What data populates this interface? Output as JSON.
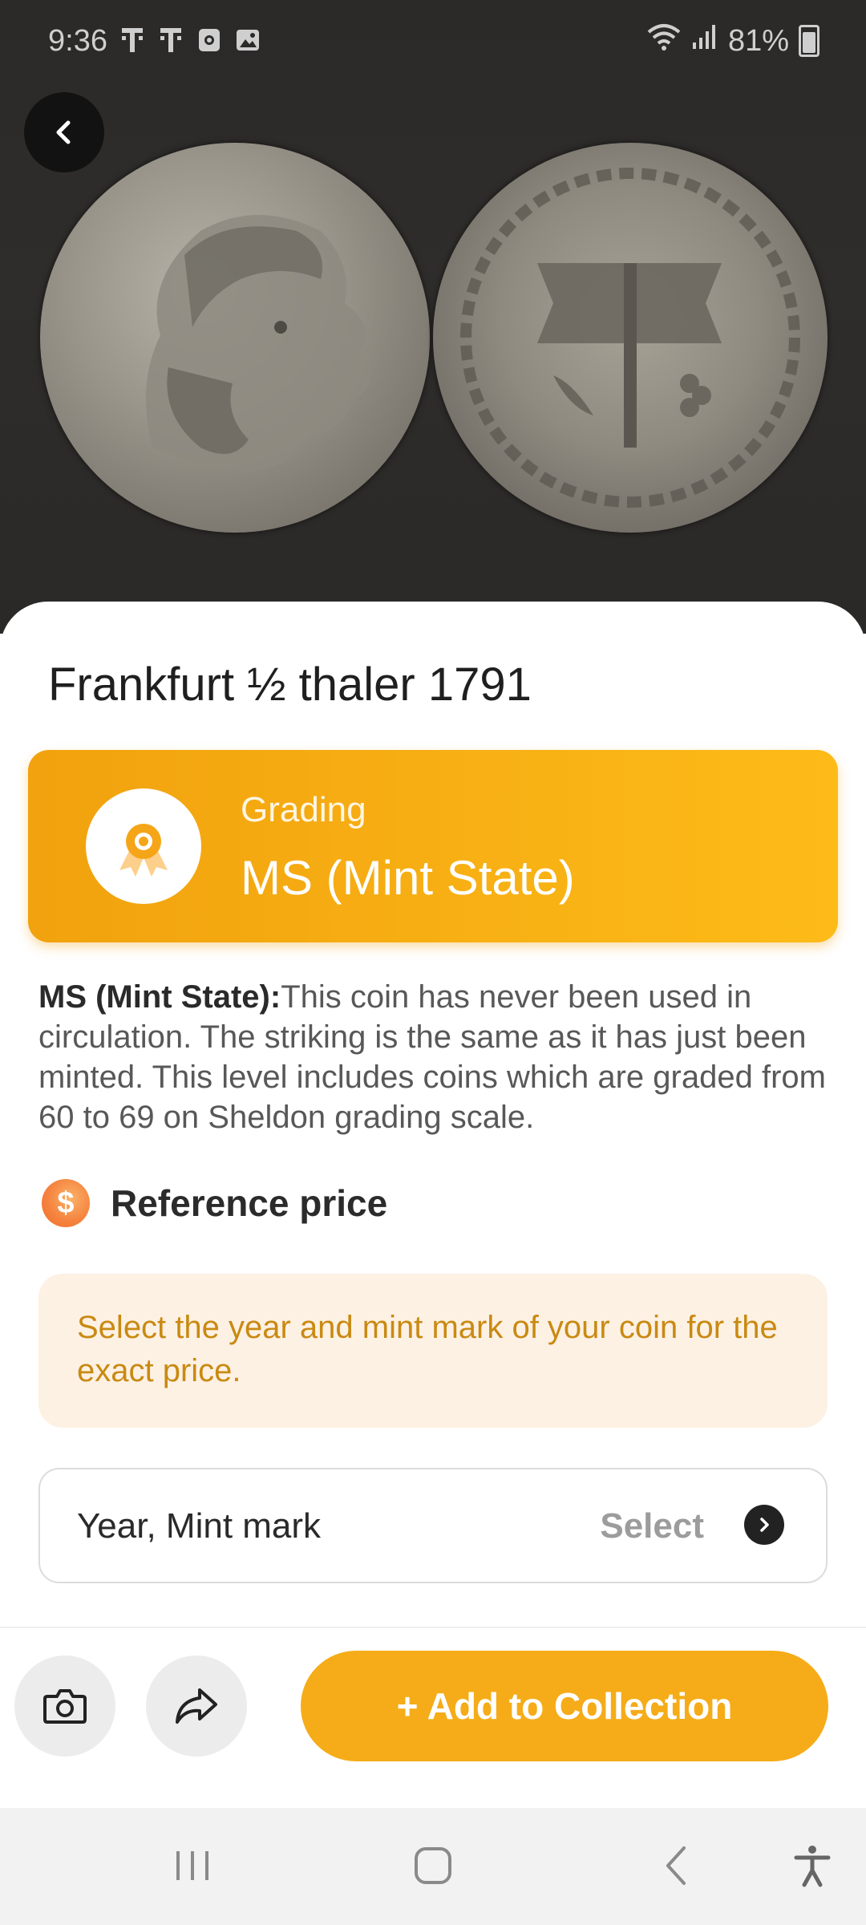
{
  "status_bar": {
    "time": "9:36",
    "battery": "81%",
    "left_icons": [
      "tmobile-icon",
      "tmobile-icon",
      "notification-icon",
      "gallery-icon"
    ],
    "right_icons": [
      "wifi-icon",
      "signal-icon",
      "battery-icon"
    ]
  },
  "coin": {
    "title": "Frankfurt ½ thaler 1791"
  },
  "grading": {
    "label": "Grading",
    "value": "MS (Mint State)",
    "icon": "award-icon",
    "accent": "#f5ac18"
  },
  "description": {
    "term": "MS (Mint State):",
    "text": "This coin has never been used in circulation. The striking is the same as it has just been minted. This level includes coins which are graded from 60 to 69 on Sheldon grading scale."
  },
  "reference_price": {
    "title": "Reference price",
    "icon_symbol": "$",
    "notice": "Select the year and mint mark of your coin for the exact price."
  },
  "year_mint": {
    "label": "Year, Mint mark",
    "action": "Select"
  },
  "actions": {
    "camera": "camera-icon",
    "share": "share-icon",
    "add_label": "+ Add to Collection"
  },
  "nav": [
    "recent-apps-icon",
    "home-icon",
    "back-icon",
    "accessibility-icon"
  ]
}
